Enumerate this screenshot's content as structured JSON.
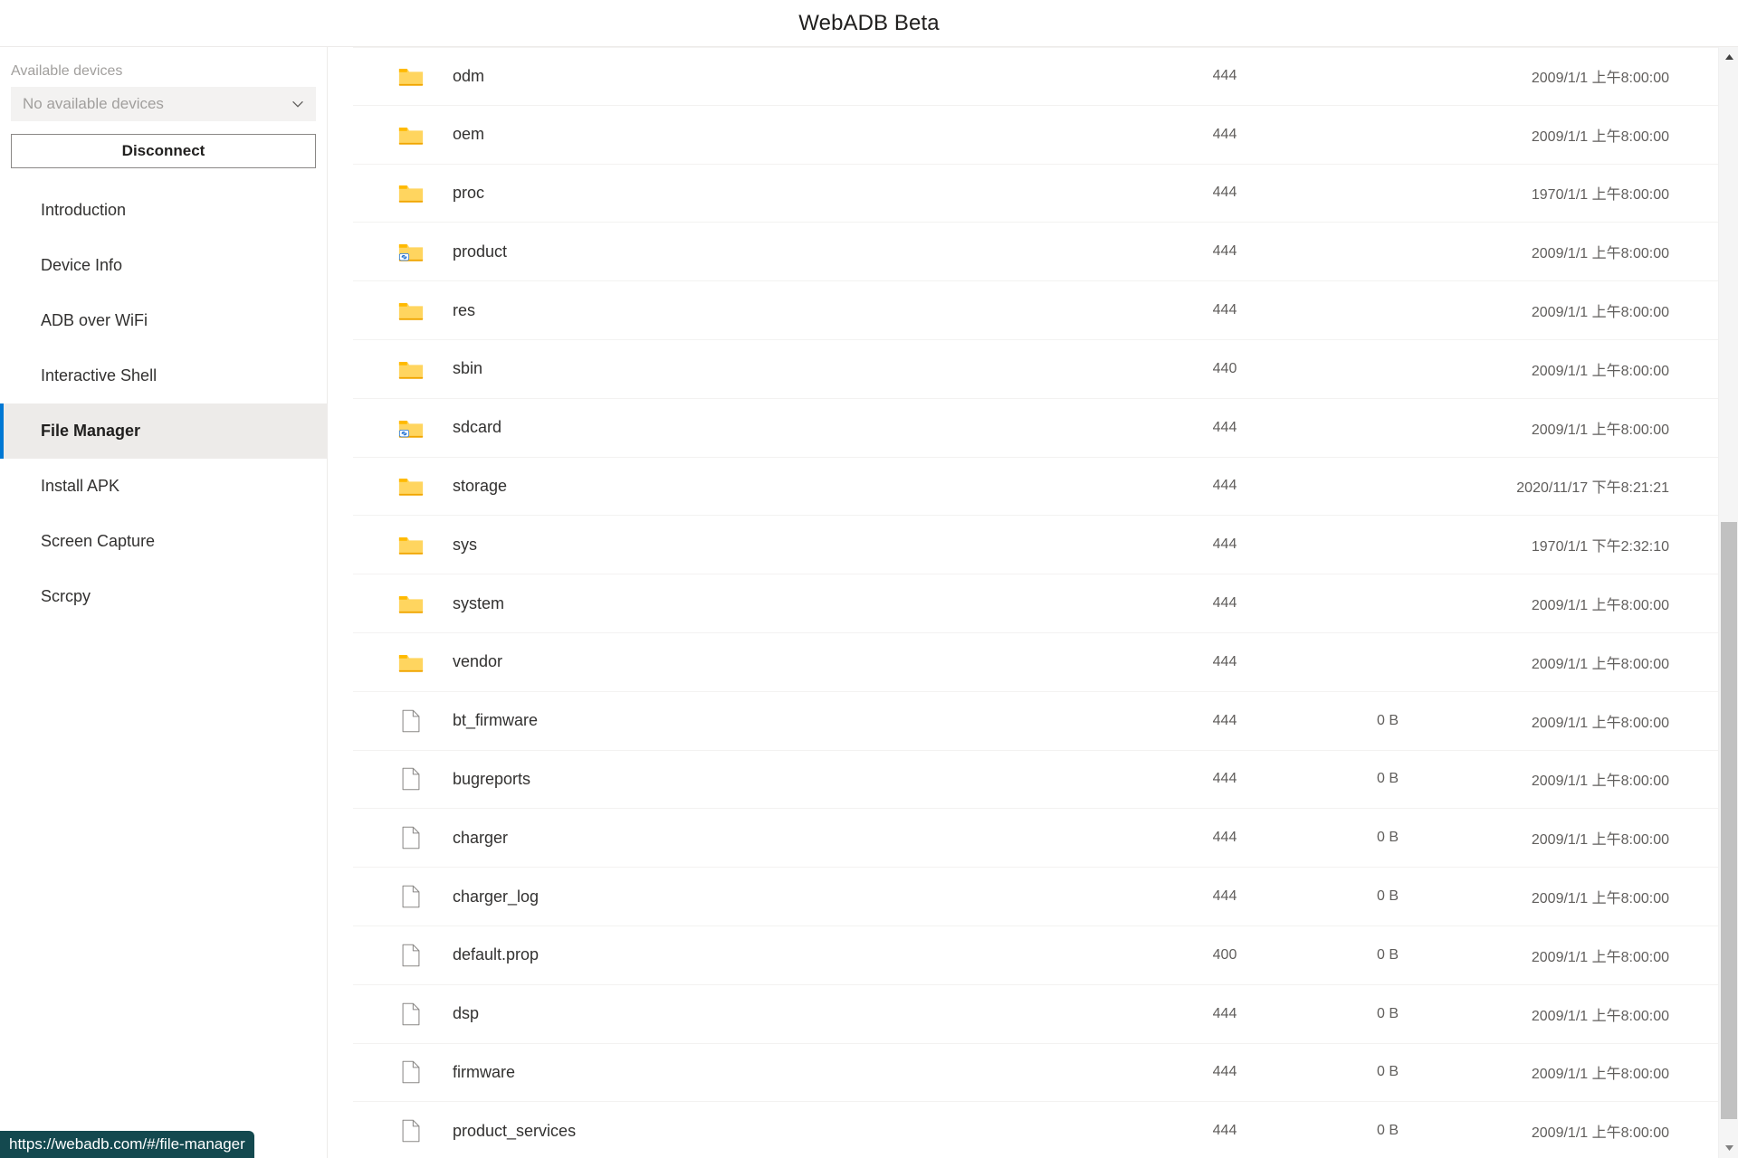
{
  "window": {
    "title": "WebADB Beta"
  },
  "sidebar": {
    "devices_label": "Available devices",
    "device_select_value": "No available devices",
    "device_select_icon": "chevron-down-icon",
    "disconnect_label": "Disconnect",
    "items": [
      {
        "label": "Introduction",
        "active": false
      },
      {
        "label": "Device Info",
        "active": false
      },
      {
        "label": "ADB over WiFi",
        "active": false
      },
      {
        "label": "Interactive Shell",
        "active": false
      },
      {
        "label": "File Manager",
        "active": true
      },
      {
        "label": "Install APK",
        "active": false
      },
      {
        "label": "Screen Capture",
        "active": false
      },
      {
        "label": "Scrcpy",
        "active": false
      }
    ]
  },
  "file_list": {
    "rows": [
      {
        "icon": "folder-icon",
        "name": "odm",
        "permission": "444",
        "size": "",
        "date": "2009/1/1 上午8:00:00"
      },
      {
        "icon": "folder-icon",
        "name": "oem",
        "permission": "444",
        "size": "",
        "date": "2009/1/1 上午8:00:00"
      },
      {
        "icon": "folder-icon",
        "name": "proc",
        "permission": "444",
        "size": "",
        "date": "1970/1/1 上午8:00:00"
      },
      {
        "icon": "folder-link-icon",
        "name": "product",
        "permission": "444",
        "size": "",
        "date": "2009/1/1 上午8:00:00"
      },
      {
        "icon": "folder-icon",
        "name": "res",
        "permission": "444",
        "size": "",
        "date": "2009/1/1 上午8:00:00"
      },
      {
        "icon": "folder-icon",
        "name": "sbin",
        "permission": "440",
        "size": "",
        "date": "2009/1/1 上午8:00:00"
      },
      {
        "icon": "folder-link-icon",
        "name": "sdcard",
        "permission": "444",
        "size": "",
        "date": "2009/1/1 上午8:00:00"
      },
      {
        "icon": "folder-icon",
        "name": "storage",
        "permission": "444",
        "size": "",
        "date": "2020/11/17 下午8:21:21"
      },
      {
        "icon": "folder-icon",
        "name": "sys",
        "permission": "444",
        "size": "",
        "date": "1970/1/1 下午2:32:10"
      },
      {
        "icon": "folder-icon",
        "name": "system",
        "permission": "444",
        "size": "",
        "date": "2009/1/1 上午8:00:00"
      },
      {
        "icon": "folder-icon",
        "name": "vendor",
        "permission": "444",
        "size": "",
        "date": "2009/1/1 上午8:00:00"
      },
      {
        "icon": "file-icon",
        "name": "bt_firmware",
        "permission": "444",
        "size": "0 B",
        "date": "2009/1/1 上午8:00:00"
      },
      {
        "icon": "file-icon",
        "name": "bugreports",
        "permission": "444",
        "size": "0 B",
        "date": "2009/1/1 上午8:00:00"
      },
      {
        "icon": "file-icon",
        "name": "charger",
        "permission": "444",
        "size": "0 B",
        "date": "2009/1/1 上午8:00:00"
      },
      {
        "icon": "file-icon",
        "name": "charger_log",
        "permission": "444",
        "size": "0 B",
        "date": "2009/1/1 上午8:00:00"
      },
      {
        "icon": "file-icon",
        "name": "default.prop",
        "permission": "400",
        "size": "0 B",
        "date": "2009/1/1 上午8:00:00"
      },
      {
        "icon": "file-icon",
        "name": "dsp",
        "permission": "444",
        "size": "0 B",
        "date": "2009/1/1 上午8:00:00"
      },
      {
        "icon": "file-icon",
        "name": "firmware",
        "permission": "444",
        "size": "0 B",
        "date": "2009/1/1 上午8:00:00"
      },
      {
        "icon": "file-icon",
        "name": "product_services",
        "permission": "444",
        "size": "0 B",
        "date": "2009/1/1 上午8:00:00"
      }
    ]
  },
  "scrollbar": {
    "up_icon": "scroll-up-arrow-icon",
    "down_icon": "scroll-down-arrow-icon"
  },
  "status_bar": {
    "url": "https://webadb.com/#/file-manager"
  },
  "colors": {
    "accent": "#0078d4",
    "folder": "#ffc83d",
    "status_bar_bg": "#14494f",
    "active_nav_bg": "#edebe9"
  }
}
